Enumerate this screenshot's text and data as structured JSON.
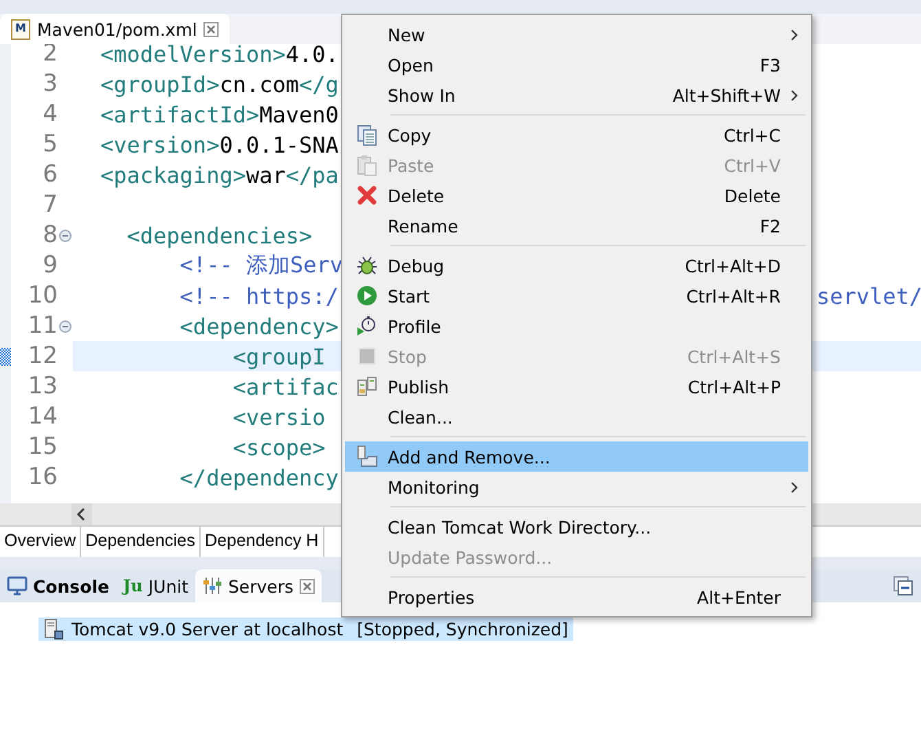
{
  "editor_tab": {
    "icon_text": "M",
    "label": "Maven01/pom.xml",
    "selected": true
  },
  "lines": [
    {
      "number": "2",
      "fold": false,
      "current": false,
      "segments": [
        {
          "kind": "tag",
          "text": "<modelVersion>"
        },
        {
          "kind": "text",
          "text": "4.0."
        }
      ]
    },
    {
      "number": "3",
      "fold": false,
      "current": false,
      "segments": [
        {
          "kind": "tag",
          "text": "<groupId>"
        },
        {
          "kind": "text",
          "text": "cn.com"
        },
        {
          "kind": "tag",
          "text": "</g"
        }
      ]
    },
    {
      "number": "4",
      "fold": false,
      "current": false,
      "segments": [
        {
          "kind": "tag",
          "text": "<artifactId>"
        },
        {
          "kind": "text",
          "text": "Maven0"
        }
      ]
    },
    {
      "number": "5",
      "fold": false,
      "current": false,
      "segments": [
        {
          "kind": "tag",
          "text": "<version>"
        },
        {
          "kind": "text",
          "text": "0.0.1-SNA"
        }
      ]
    },
    {
      "number": "6",
      "fold": false,
      "current": false,
      "segments": [
        {
          "kind": "tag",
          "text": "<packaging>"
        },
        {
          "kind": "text",
          "text": "war"
        },
        {
          "kind": "tag",
          "text": "</pa"
        }
      ]
    },
    {
      "number": "7",
      "fold": false,
      "current": false
    },
    {
      "number": "8",
      "fold": true,
      "current": false,
      "segments": [
        {
          "kind": "tag",
          "text": "  <dependencies>"
        }
      ]
    },
    {
      "number": "9",
      "fold": false,
      "current": false,
      "segments": [
        {
          "kind": "comment",
          "text": "      <!-- 添加Serv"
        }
      ]
    },
    {
      "number": "10",
      "fold": false,
      "current": false,
      "segments": [
        {
          "kind": "comment",
          "text": "      <!-- https:/"
        }
      ],
      "tail": "servlet/"
    },
    {
      "number": "11",
      "fold": true,
      "current": false,
      "segments": [
        {
          "kind": "tag",
          "text": "      <dependency>"
        }
      ]
    },
    {
      "number": "12",
      "fold": false,
      "current": true,
      "segments": [
        {
          "kind": "tag",
          "text": "          <groupI"
        }
      ]
    },
    {
      "number": "13",
      "fold": false,
      "current": false,
      "segments": [
        {
          "kind": "tag",
          "text": "          <artifac"
        }
      ]
    },
    {
      "number": "14",
      "fold": false,
      "current": false,
      "segments": [
        {
          "kind": "tag",
          "text": "          <versio"
        }
      ]
    },
    {
      "number": "15",
      "fold": false,
      "current": false,
      "segments": [
        {
          "kind": "tag",
          "text": "          <scope>"
        }
      ]
    },
    {
      "number": "16",
      "fold": false,
      "current": false,
      "segments": [
        {
          "kind": "tag",
          "text": "      </dependency"
        }
      ]
    }
  ],
  "editor_pages": [
    {
      "label": "Overview",
      "selected": false
    },
    {
      "label": "Dependencies",
      "selected": false
    },
    {
      "label": "Dependency H",
      "selected": false
    }
  ],
  "panel_tabs": [
    {
      "kind": "console",
      "label": "Console",
      "selected": false
    },
    {
      "kind": "junit",
      "icon_text": "Ju",
      "label": "JUnit",
      "selected": false
    },
    {
      "kind": "servers",
      "label": "Servers",
      "selected": true
    }
  ],
  "servers": [
    {
      "name": "Tomcat v9.0 Server at localhost",
      "status": "[Stopped, Synchronized]",
      "selected": true
    }
  ],
  "context_menu": [
    {
      "kind": "item",
      "label": "New",
      "submenu": true,
      "disabled": false,
      "selected": false
    },
    {
      "kind": "item",
      "label": "Open",
      "shortcut": "F3",
      "submenu": false,
      "disabled": false,
      "selected": false
    },
    {
      "kind": "item",
      "label": "Show In",
      "shortcut": "Alt+Shift+W",
      "submenu": true,
      "disabled": false,
      "selected": false
    },
    {
      "kind": "separator"
    },
    {
      "kind": "item",
      "label": "Copy",
      "shortcut": "Ctrl+C",
      "submenu": false,
      "disabled": false,
      "selected": false
    },
    {
      "kind": "item",
      "label": "Paste",
      "shortcut": "Ctrl+V",
      "submenu": false,
      "disabled": true,
      "selected": false
    },
    {
      "kind": "item",
      "label": "Delete",
      "shortcut": "Delete",
      "submenu": false,
      "disabled": false,
      "selected": false
    },
    {
      "kind": "item",
      "label": "Rename",
      "shortcut": "F2",
      "submenu": false,
      "disabled": false,
      "selected": false
    },
    {
      "kind": "separator"
    },
    {
      "kind": "item",
      "label": "Debug",
      "shortcut": "Ctrl+Alt+D",
      "submenu": false,
      "disabled": false,
      "selected": false
    },
    {
      "kind": "item",
      "label": "Start",
      "shortcut": "Ctrl+Alt+R",
      "submenu": false,
      "disabled": false,
      "selected": false
    },
    {
      "kind": "item",
      "label": "Profile",
      "submenu": false,
      "disabled": false,
      "selected": false
    },
    {
      "kind": "item",
      "label": "Stop",
      "shortcut": "Ctrl+Alt+S",
      "submenu": false,
      "disabled": true,
      "selected": false
    },
    {
      "kind": "item",
      "label": "Publish",
      "shortcut": "Ctrl+Alt+P",
      "submenu": false,
      "disabled": false,
      "selected": false
    },
    {
      "kind": "item",
      "label": "Clean...",
      "submenu": false,
      "disabled": false,
      "selected": false
    },
    {
      "kind": "separator"
    },
    {
      "kind": "item",
      "label": "Add and Remove...",
      "submenu": false,
      "disabled": false,
      "selected": true
    },
    {
      "kind": "item",
      "label": "Monitoring",
      "submenu": true,
      "disabled": false,
      "selected": false
    },
    {
      "kind": "separator"
    },
    {
      "kind": "item",
      "label": "Clean Tomcat Work Directory...",
      "submenu": false,
      "disabled": false,
      "selected": false
    },
    {
      "kind": "item",
      "label": "Update Password...",
      "submenu": false,
      "disabled": true,
      "selected": false
    },
    {
      "kind": "separator"
    },
    {
      "kind": "item",
      "label": "Properties",
      "shortcut": "Alt+Enter",
      "submenu": false,
      "disabled": false,
      "selected": false
    }
  ]
}
